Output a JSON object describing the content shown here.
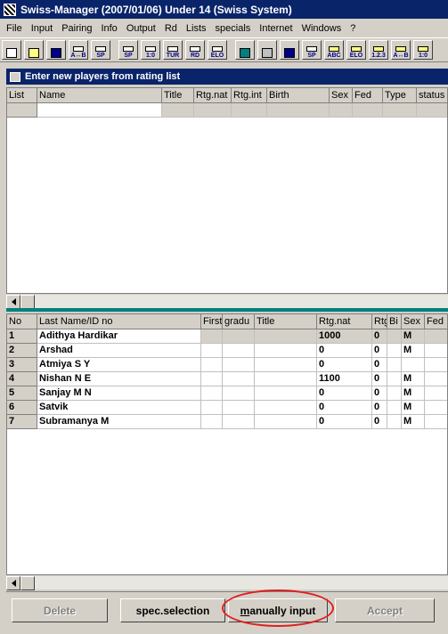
{
  "window": {
    "title": "Swiss-Manager (2007/01/06)  Under 14    (Swiss System)"
  },
  "menu": [
    "File",
    "Input",
    "Pairing",
    "Info",
    "Output",
    "Rd",
    "Lists",
    "specials",
    "Internet",
    "Windows",
    "?"
  ],
  "toolbar": {
    "icons": [
      {
        "name": "new-file-icon",
        "label": ""
      },
      {
        "name": "open-folder-icon",
        "label": ""
      },
      {
        "name": "save-disk-icon",
        "label": ""
      },
      {
        "name": "swap-ab-icon",
        "label": "A↔B"
      },
      {
        "name": "sp-doc-icon",
        "label": "SP"
      },
      {
        "name": "sp-list-icon",
        "label": "SP"
      },
      {
        "name": "result-icon",
        "label": "1:0"
      },
      {
        "name": "tur-icon",
        "label": "TUR"
      },
      {
        "name": "rd-icon",
        "label": "RD"
      },
      {
        "name": "elo-icon",
        "label": "ELO"
      },
      {
        "name": "screen-icon",
        "label": ""
      },
      {
        "name": "printer-icon",
        "label": ""
      },
      {
        "name": "save-icon",
        "label": ""
      },
      {
        "name": "sp-print-icon",
        "label": "SP"
      },
      {
        "name": "sort-abc-icon",
        "label": "ABC"
      },
      {
        "name": "sort-elo-icon",
        "label": "ELO"
      },
      {
        "name": "sort-123-icon",
        "label": "1.2.3"
      },
      {
        "name": "sort-ab-icon",
        "label": "A↔B"
      },
      {
        "name": "sort-result-icon",
        "label": "1:0"
      }
    ]
  },
  "child_window": {
    "title": "Enter new players from rating list"
  },
  "rating_list": {
    "columns": [
      "List",
      "Name",
      "Title",
      "Rtg.nat",
      "Rtg.int",
      "Birth",
      "Sex",
      "Fed",
      "Type",
      "status"
    ]
  },
  "players": {
    "columns": [
      "No",
      "Last Name/ID no",
      "First",
      "gradu",
      "Title",
      "Rtg.nat",
      "Rtg.int",
      "Bi",
      "Sex",
      "Fed"
    ],
    "rows": [
      {
        "no": "1",
        "name": "Adithya Hardikar",
        "rtg_nat": "1000",
        "rtg_int": "0",
        "sex": "M"
      },
      {
        "no": "2",
        "name": "Arshad",
        "rtg_nat": "0",
        "rtg_int": "0",
        "sex": "M"
      },
      {
        "no": "3",
        "name": "Atmiya S Y",
        "rtg_nat": "0",
        "rtg_int": "0",
        "sex": ""
      },
      {
        "no": "4",
        "name": "Nishan N E",
        "rtg_nat": "1100",
        "rtg_int": "0",
        "sex": "M"
      },
      {
        "no": "5",
        "name": "Sanjay M N",
        "rtg_nat": "0",
        "rtg_int": "0",
        "sex": "M"
      },
      {
        "no": "6",
        "name": "Satvik",
        "rtg_nat": "0",
        "rtg_int": "0",
        "sex": "M"
      },
      {
        "no": "7",
        "name": "Subramanya M",
        "rtg_nat": "0",
        "rtg_int": "0",
        "sex": "M"
      }
    ]
  },
  "buttons": {
    "delete": "Delete",
    "spec_selection": "spec.selection",
    "manually_input_key": "m",
    "manually_input_rest": "anually input",
    "accept": "Accept"
  },
  "colors": {
    "titlebar": "#0a246a",
    "splitter": "#008080",
    "highlight": "#e02020"
  }
}
